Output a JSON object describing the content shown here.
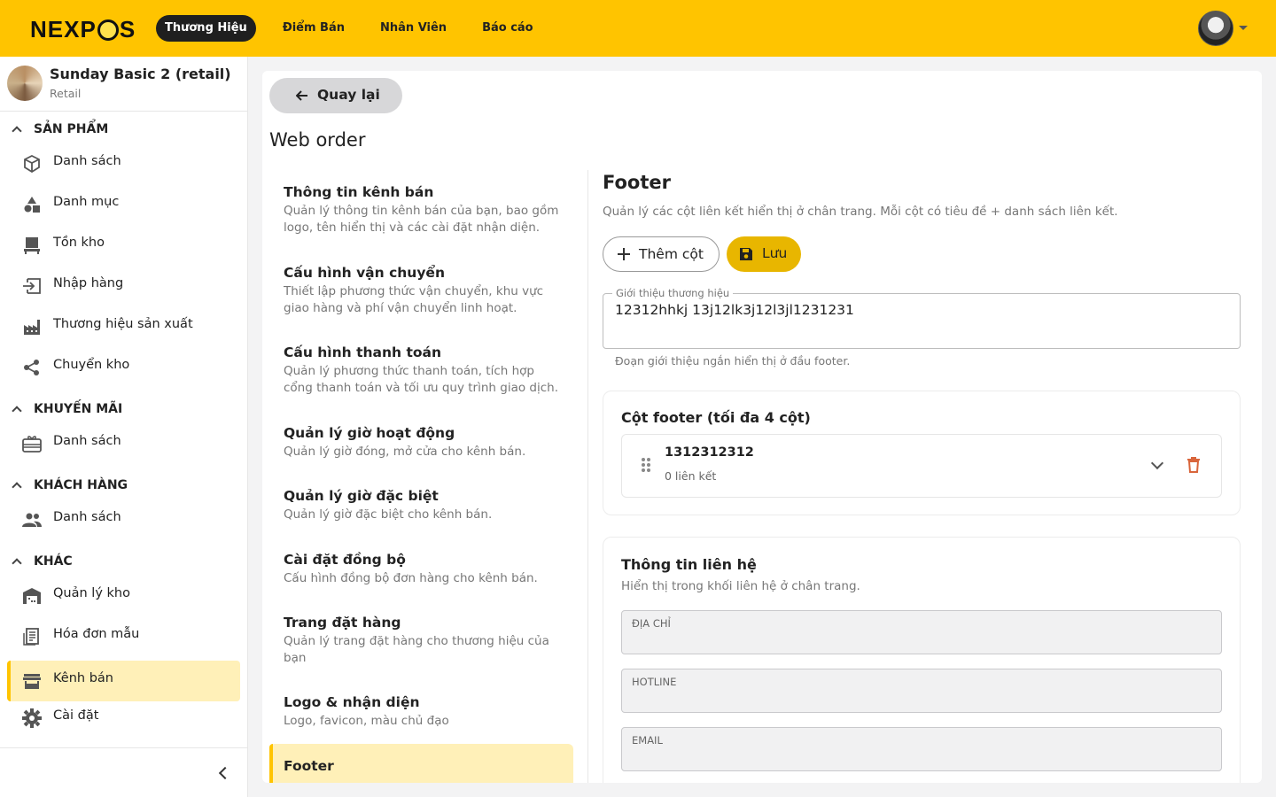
{
  "brand": {
    "logo_text": "NEXPOS"
  },
  "topnav": {
    "items": [
      {
        "label": "Thương Hiệu",
        "active": true
      },
      {
        "label": "Điểm Bán",
        "active": false
      },
      {
        "label": "Nhân Viên",
        "active": false
      },
      {
        "label": "Báo cáo",
        "active": false
      }
    ]
  },
  "store": {
    "name": "Sunday Basic 2 (retail)",
    "type": "Retail"
  },
  "sidebar": {
    "sections": [
      {
        "title": "SẢN PHẨM",
        "items": [
          "Danh sách",
          "Danh mục",
          "Tồn kho",
          "Nhập hàng",
          "Thương hiệu sản xuất",
          "Chuyển kho"
        ]
      },
      {
        "title": "KHUYẾN MÃI",
        "items": [
          "Danh sách"
        ]
      },
      {
        "title": "KHÁCH HÀNG",
        "items": [
          "Danh sách"
        ]
      },
      {
        "title": "KHÁC",
        "items": [
          "Quản lý kho",
          "Hóa đơn mẫu",
          "Kênh bán",
          "Cài đặt"
        ]
      }
    ],
    "active_item": "Kênh bán"
  },
  "main": {
    "back_label": "Quay lại",
    "page_title": "Web order",
    "settings": [
      {
        "title": "Thông tin kênh bán",
        "desc": "Quản lý thông tin kênh bán của bạn, bao gồm logo, tên hiển thị và các cài đặt nhận diện."
      },
      {
        "title": "Cấu hình vận chuyển",
        "desc": "Thiết lập phương thức vận chuyển, khu vực giao hàng và phí vận chuyển linh hoạt."
      },
      {
        "title": "Cấu hình thanh toán",
        "desc": "Quản lý phương thức thanh toán, tích hợp cổng thanh toán và tối ưu quy trình giao dịch."
      },
      {
        "title": "Quản lý giờ hoạt động",
        "desc": "Quản lý giờ đóng, mở cửa cho kênh bán."
      },
      {
        "title": "Quản lý giờ đặc biệt",
        "desc": "Quản lý giờ đặc biệt cho kênh bán."
      },
      {
        "title": "Cài đặt đồng bộ",
        "desc": "Cấu hình đồng bộ đơn hàng cho kênh bán."
      },
      {
        "title": "Trang đặt hàng",
        "desc": "Quản lý trang đặt hàng cho thương hiệu của bạn"
      },
      {
        "title": "Logo & nhận diện",
        "desc": "Logo, favicon, màu chủ đạo"
      },
      {
        "title": "Footer",
        "desc": "",
        "active": true
      }
    ]
  },
  "footer": {
    "title": "Footer",
    "desc": "Quản lý các cột liên kết hiển thị ở chân trang. Mỗi cột có tiêu đề + danh sách liên kết.",
    "add_column_label": "Thêm cột",
    "save_label": "Lưu",
    "intro": {
      "label": "Giới thiệu thương hiệu",
      "value": "12312hhkj 13j12lk3j12l3jl1231231",
      "help": "Đoạn giới thiệu ngắn hiển thị ở đầu footer."
    },
    "columns_card": {
      "title": "Cột footer (tối đa 4 cột)",
      "columns": [
        {
          "name": "1312312312",
          "links": "0 liên kết"
        }
      ]
    },
    "contact": {
      "title": "Thông tin liên hệ",
      "desc": "Hiển thị trong khối liên hệ ở chân trang.",
      "fields": [
        {
          "label": "ĐỊA CHỈ",
          "value": ""
        },
        {
          "label": "HOTLINE",
          "value": ""
        },
        {
          "label": "EMAIL",
          "value": ""
        }
      ]
    }
  },
  "colors": {
    "brand_yellow": "#ffc400",
    "active_bg": "#fff0b8",
    "save_button": "#e8b600",
    "delete_icon": "#d9653b"
  }
}
